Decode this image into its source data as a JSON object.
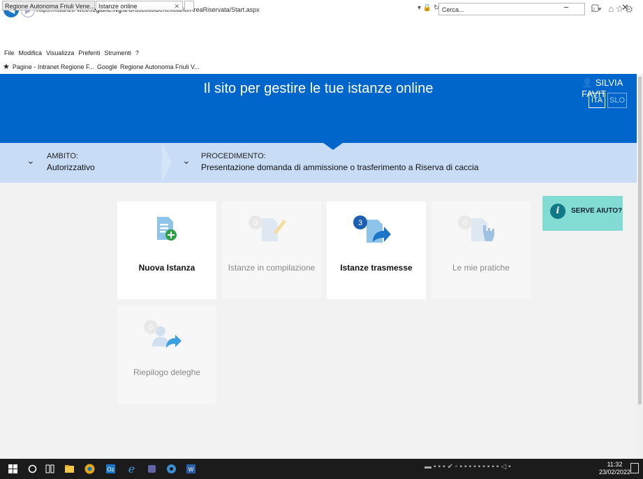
{
  "browser": {
    "url_prefix": "https://istanze-web.",
    "url_domain": "regione.fvg.it",
    "url_path": "/CruscottoBeneficiario/AreaRiservata/Start.aspx",
    "search_placeholder": "Cerca...",
    "window_controls": "− ▢ ✕",
    "tabs": [
      {
        "label": "Regione Autonoma Friuli Vene..."
      },
      {
        "label": "Istanze online"
      }
    ],
    "menu": [
      "File",
      "Modifica",
      "Visualizza",
      "Preferiti",
      "Strumenti",
      "?"
    ],
    "favorites": [
      "Pagine - Intranet Regione F...",
      "Google",
      "Regione Autonoma Friuli V..."
    ]
  },
  "header": {
    "title": "Il sito per gestire le tue istanze online",
    "user": "SILVIA FAVIT",
    "lang_active": "ITA",
    "lang_other": "SLO"
  },
  "breadcrumb": {
    "ambito_label": "AMBITO:",
    "ambito_value": "Autorizzativo",
    "procedimento_label": "PROCEDIMENTO:",
    "procedimento_value": "Presentazione domanda di ammissione o trasferimento a Riserva di caccia"
  },
  "cards": [
    {
      "title": "Nuova Istanza",
      "count": ""
    },
    {
      "title": "Istanze in compilazione",
      "count": "0"
    },
    {
      "title": "Istanze trasmesse",
      "count": "3"
    },
    {
      "title": "Le mie pratiche",
      "count": "0"
    },
    {
      "title": "Riepilogo deleghe",
      "count": "0"
    }
  ],
  "help": {
    "label": "SERVE AIUTO?"
  },
  "taskbar": {
    "time": "11:32",
    "date": "23/02/2022"
  },
  "colors": {
    "header_blue": "#0066cc",
    "band": "#c8dcf5",
    "help_bg": "#82dcd4",
    "card_icon_blue": "#1b76c8"
  }
}
